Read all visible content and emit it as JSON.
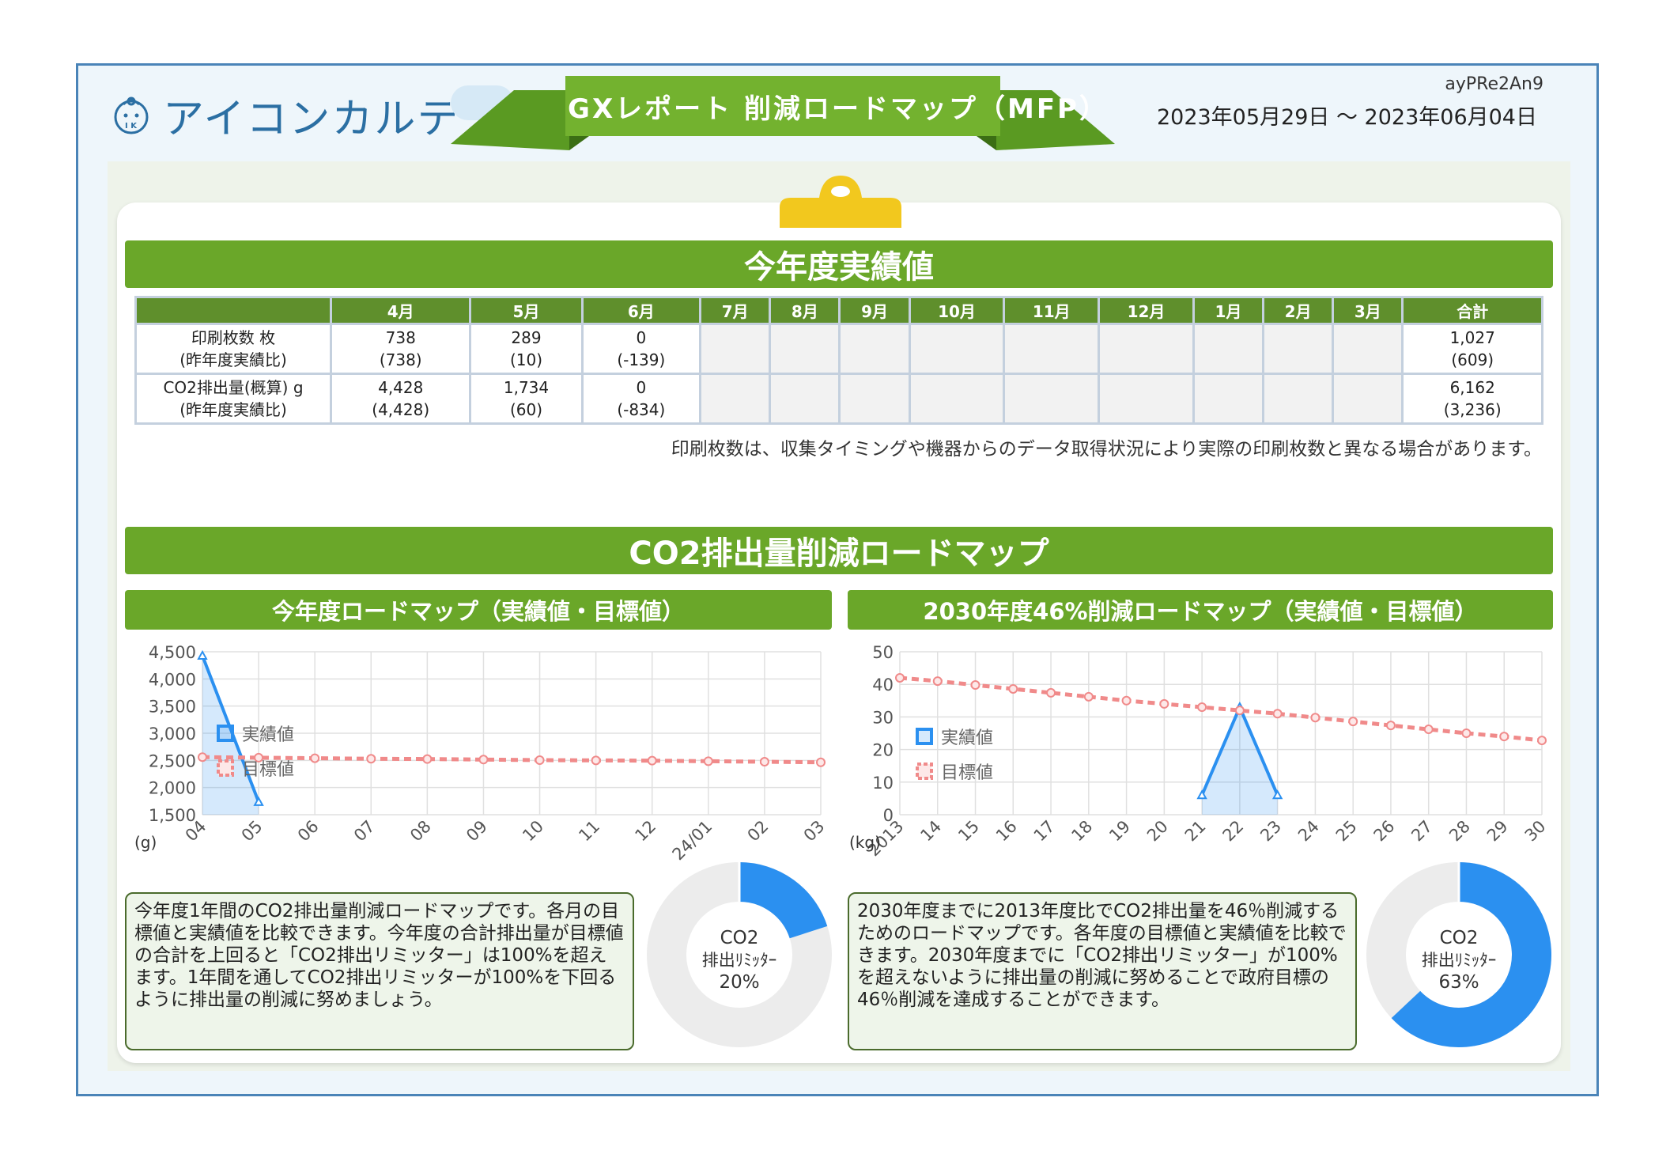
{
  "header": {
    "brand": "アイコンカルテ",
    "title": "GXレポート 削減ロードマップ（MFP）",
    "code": "ayPRe2An9",
    "period": "2023年05月29日 ～ 2023年06月04日"
  },
  "colors": {
    "green": "#6aa729",
    "blue": "#2b90f0",
    "target": "#f08a8a",
    "brand": "#2b6fa3"
  },
  "section1": {
    "title": "今年度実績値",
    "columns": [
      "",
      "4月",
      "5月",
      "6月",
      "7月",
      "8月",
      "9月",
      "10月",
      "11月",
      "12月",
      "1月",
      "2月",
      "3月",
      "合計"
    ],
    "rows": [
      {
        "label1": "印刷枚数 枚",
        "label2": "(昨年度実績比)",
        "cells": [
          [
            "738",
            "(738)"
          ],
          [
            "289",
            "(10)"
          ],
          [
            "0",
            "(-139)"
          ],
          null,
          null,
          null,
          null,
          null,
          null,
          null,
          null,
          null,
          [
            "1,027",
            "(609)"
          ]
        ]
      },
      {
        "label1": "CO2排出量(概算) g",
        "label2": "(昨年度実績比)",
        "cells": [
          [
            "4,428",
            "(4,428)"
          ],
          [
            "1,734",
            "(60)"
          ],
          [
            "0",
            "(-834)"
          ],
          null,
          null,
          null,
          null,
          null,
          null,
          null,
          null,
          null,
          [
            "6,162",
            "(3,236)"
          ]
        ]
      }
    ],
    "note": "印刷枚数は、収集タイミングや機器からのデータ取得状況により実際の印刷枚数と異なる場合があります。"
  },
  "section2": {
    "title": "CO2排出量削減ロードマップ",
    "left": {
      "title": "今年度ロードマップ（実績値・目標値）",
      "description": "今年度1年間のCO2排出量削減ロードマップです。各月の目標値と実績値を比較できます。今年度の合計排出量が目標値の合計を上回ると「CO2排出リミッター」は100%を超えます。1年間を通してCO2排出リミッターが100%を下回るように排出量の削減に努めましょう。",
      "donut": {
        "line1": "CO2",
        "line2": "排出ﾘﾐｯﾀｰ",
        "pct_label": "20%",
        "pct": 20
      }
    },
    "right": {
      "title": "2030年度46%削減ロードマップ（実績値・目標値）",
      "description": "2030年度までに2013年度比でCO2排出量を46％削減するためのロードマップです。各年度の目標値と実績値を比較できます。2030年度までに「CO2排出リミッター」が100%を超えないように排出量の削減に努めることで政府目標の46％削減を達成することができます。",
      "donut": {
        "line1": "CO2",
        "line2": "排出ﾘﾐｯﾀｰ",
        "pct_label": "63%",
        "pct": 63
      }
    }
  },
  "chart_data": [
    {
      "type": "line",
      "x": [
        "04",
        "05",
        "06",
        "07",
        "08",
        "09",
        "10",
        "11",
        "12",
        "24/01",
        "02",
        "03"
      ],
      "series": [
        {
          "name": "実績値",
          "values": [
            4428,
            1734,
            null,
            null,
            null,
            null,
            null,
            null,
            null,
            null,
            null,
            null
          ]
        },
        {
          "name": "目標値",
          "values": [
            2560,
            2550,
            2540,
            2530,
            2525,
            2515,
            2505,
            2500,
            2495,
            2485,
            2475,
            2465
          ]
        }
      ],
      "ylabel": "(g)",
      "ylim": [
        1500,
        4500
      ],
      "yticks": [
        "1,500",
        "2,000",
        "2,500",
        "3,000",
        "3,500",
        "4,000",
        "4,500"
      ],
      "grid": true,
      "legend": "left"
    },
    {
      "type": "line",
      "x": [
        "2013",
        "14",
        "15",
        "16",
        "17",
        "18",
        "19",
        "20",
        "21",
        "22",
        "23",
        "24",
        "25",
        "26",
        "27",
        "28",
        "29",
        "30"
      ],
      "series": [
        {
          "name": "実績値",
          "values": [
            null,
            null,
            null,
            null,
            null,
            null,
            null,
            null,
            6,
            33,
            6,
            null,
            null,
            null,
            null,
            null,
            null,
            null
          ]
        },
        {
          "name": "目標値",
          "values": [
            42,
            41,
            39.8,
            38.6,
            37.4,
            36.2,
            35,
            34,
            33,
            32,
            31,
            29.8,
            28.6,
            27.4,
            26.2,
            25,
            24,
            22.8
          ]
        }
      ],
      "ylabel": "(kg)",
      "ylim": [
        0,
        50
      ],
      "yticks": [
        "0",
        "10",
        "20",
        "30",
        "40",
        "50"
      ],
      "grid": true,
      "legend": "left"
    }
  ]
}
